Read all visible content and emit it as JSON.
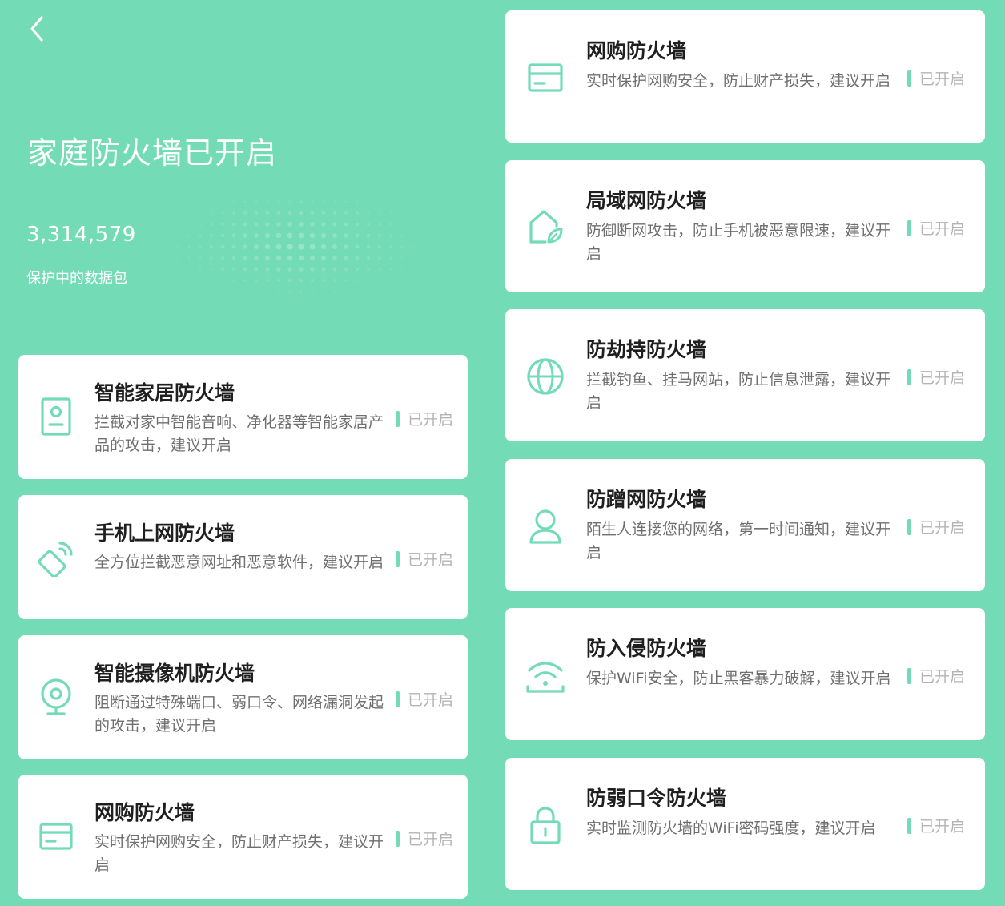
{
  "header": {
    "back_icon": "chevron-left-icon",
    "title": "家庭防火墙已开启",
    "packet_count": "3,314,579",
    "packet_label": "保护中的数据包"
  },
  "colors": {
    "background": "#74dbb7",
    "accent": "#74dbb7",
    "card": "#ffffff"
  },
  "left_cards": [
    {
      "icon": "smart-home-icon",
      "title": "智能家居防火墙",
      "desc": "拦截对家中智能音响、净化器等智能家居产品的攻击，建议开启",
      "status": "已开启"
    },
    {
      "icon": "mobile-signal-icon",
      "title": "手机上网防火墙",
      "desc": "全方位拦截恶意网址和恶意软件，建议开启",
      "status": "已开启"
    },
    {
      "icon": "camera-icon",
      "title": "智能摄像机防火墙",
      "desc": "阻断通过特殊端口、弱口令、网络漏洞发起的攻击，建议开启",
      "status": "已开启"
    },
    {
      "icon": "credit-card-icon",
      "title": "网购防火墙",
      "desc": "实时保护网购安全，防止财产损失，建议开启",
      "status": "已开启"
    }
  ],
  "right_cards": [
    {
      "icon": "credit-card-icon",
      "title": "网购防火墙",
      "desc": "实时保护网购安全，防止财产损失，建议开启",
      "status": "已开启"
    },
    {
      "icon": "home-leaf-icon",
      "title": "局域网防火墙",
      "desc": "防御断网攻击，防止手机被恶意限速，建议开启",
      "status": "已开启"
    },
    {
      "icon": "globe-icon",
      "title": "防劫持防火墙",
      "desc": "拦截钓鱼、挂马网站，防止信息泄露，建议开启",
      "status": "已开启"
    },
    {
      "icon": "user-icon",
      "title": "防蹭网防火墙",
      "desc": "陌生人连接您的网络，第一时间通知，建议开启",
      "status": "已开启"
    },
    {
      "icon": "wifi-icon",
      "title": "防入侵防火墙",
      "desc": "保护WiFi安全，防止黑客暴力破解，建议开启",
      "status": "已开启"
    },
    {
      "icon": "lock-icon",
      "title": "防弱口令防火墙",
      "desc": "实时监测防火墙的WiFi密码强度，建议开启",
      "status": "已开启"
    }
  ]
}
